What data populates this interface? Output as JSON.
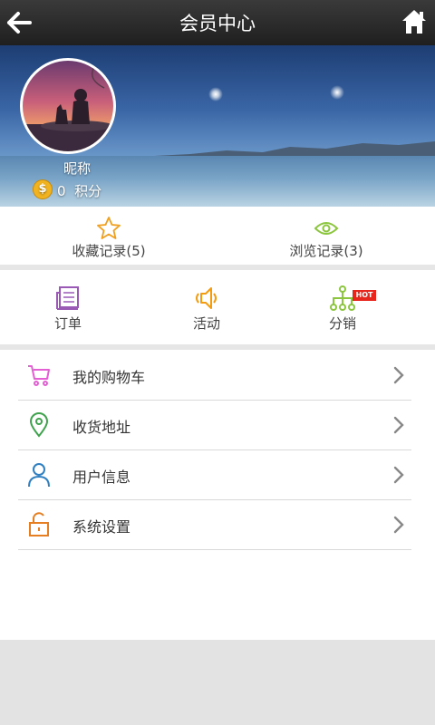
{
  "header": {
    "title": "会员中心",
    "back_icon": "back-arrow-icon",
    "home_icon": "home-icon"
  },
  "profile": {
    "nickname": "昵称",
    "points_value": "0",
    "points_label": "积分",
    "coin_icon": "coin-icon"
  },
  "records": [
    {
      "label": "收藏记录(5)",
      "icon": "star-icon",
      "color": "#f0a020"
    },
    {
      "label": "浏览记录(3)",
      "icon": "eye-icon",
      "color": "#8cc63f"
    }
  ],
  "shortcuts": [
    {
      "label": "订单",
      "icon": "order-icon",
      "color": "#9b59b6"
    },
    {
      "label": "活动",
      "icon": "speaker-icon",
      "color": "#f39c12"
    },
    {
      "label": "分销",
      "icon": "distribution-icon",
      "color": "#8cc63f",
      "badge": "HOT"
    }
  ],
  "menu": [
    {
      "label": "我的购物车",
      "icon": "cart-icon",
      "color": "#e35fd3"
    },
    {
      "label": "收货地址",
      "icon": "location-icon",
      "color": "#3fa34d"
    },
    {
      "label": "用户信息",
      "icon": "user-icon",
      "color": "#2f7fc1"
    },
    {
      "label": "系统设置",
      "icon": "unlock-icon",
      "color": "#e67e22"
    }
  ],
  "colors": {
    "header_bg": "#262626",
    "page_bg": "#e6e6e6",
    "divider": "#d9d9d9"
  }
}
